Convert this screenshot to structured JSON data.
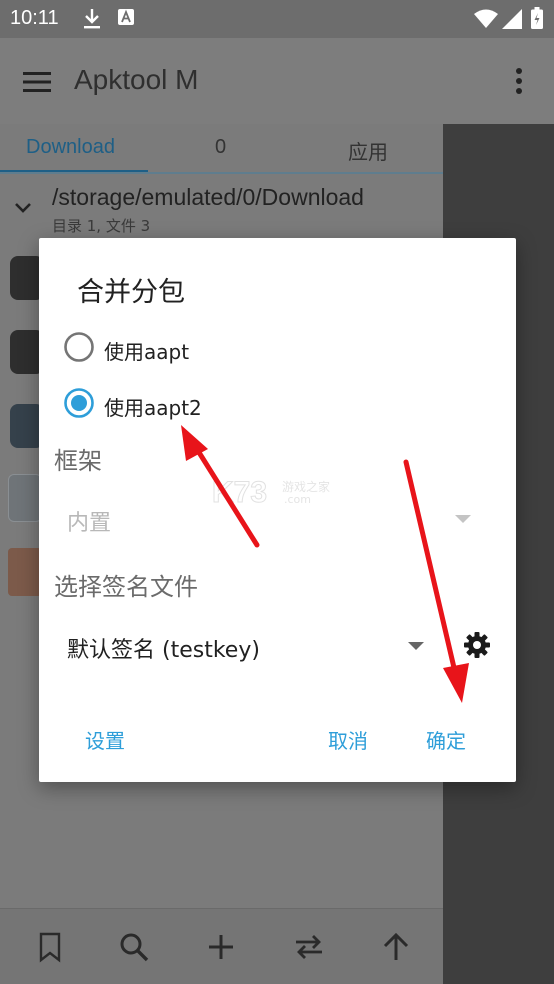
{
  "status_bar": {
    "time": "10:11"
  },
  "app_bar": {
    "title": "Apktool M"
  },
  "tabs": [
    {
      "label": "Download"
    },
    {
      "label": "0"
    },
    {
      "label": "应用"
    }
  ],
  "path_row": {
    "path": "/storage/emulated/0/Download",
    "summary": "目录 1, 文件 3"
  },
  "dialog": {
    "title": "合并分包",
    "radio_options": [
      {
        "label": "使用aapt",
        "selected": false
      },
      {
        "label": "使用aapt2",
        "selected": true
      }
    ],
    "framework_label": "框架",
    "framework_value": "内置",
    "signature_label": "选择签名文件",
    "signature_value": "默认签名 (testkey)",
    "buttons": {
      "settings": "设置",
      "cancel": "取消",
      "ok": "确定"
    }
  },
  "watermark": {
    "logo": "K73",
    "text": "游戏之家",
    "domain": ".com"
  },
  "colors": {
    "accent": "#2e9ed9",
    "arrow": "#e8141a"
  }
}
